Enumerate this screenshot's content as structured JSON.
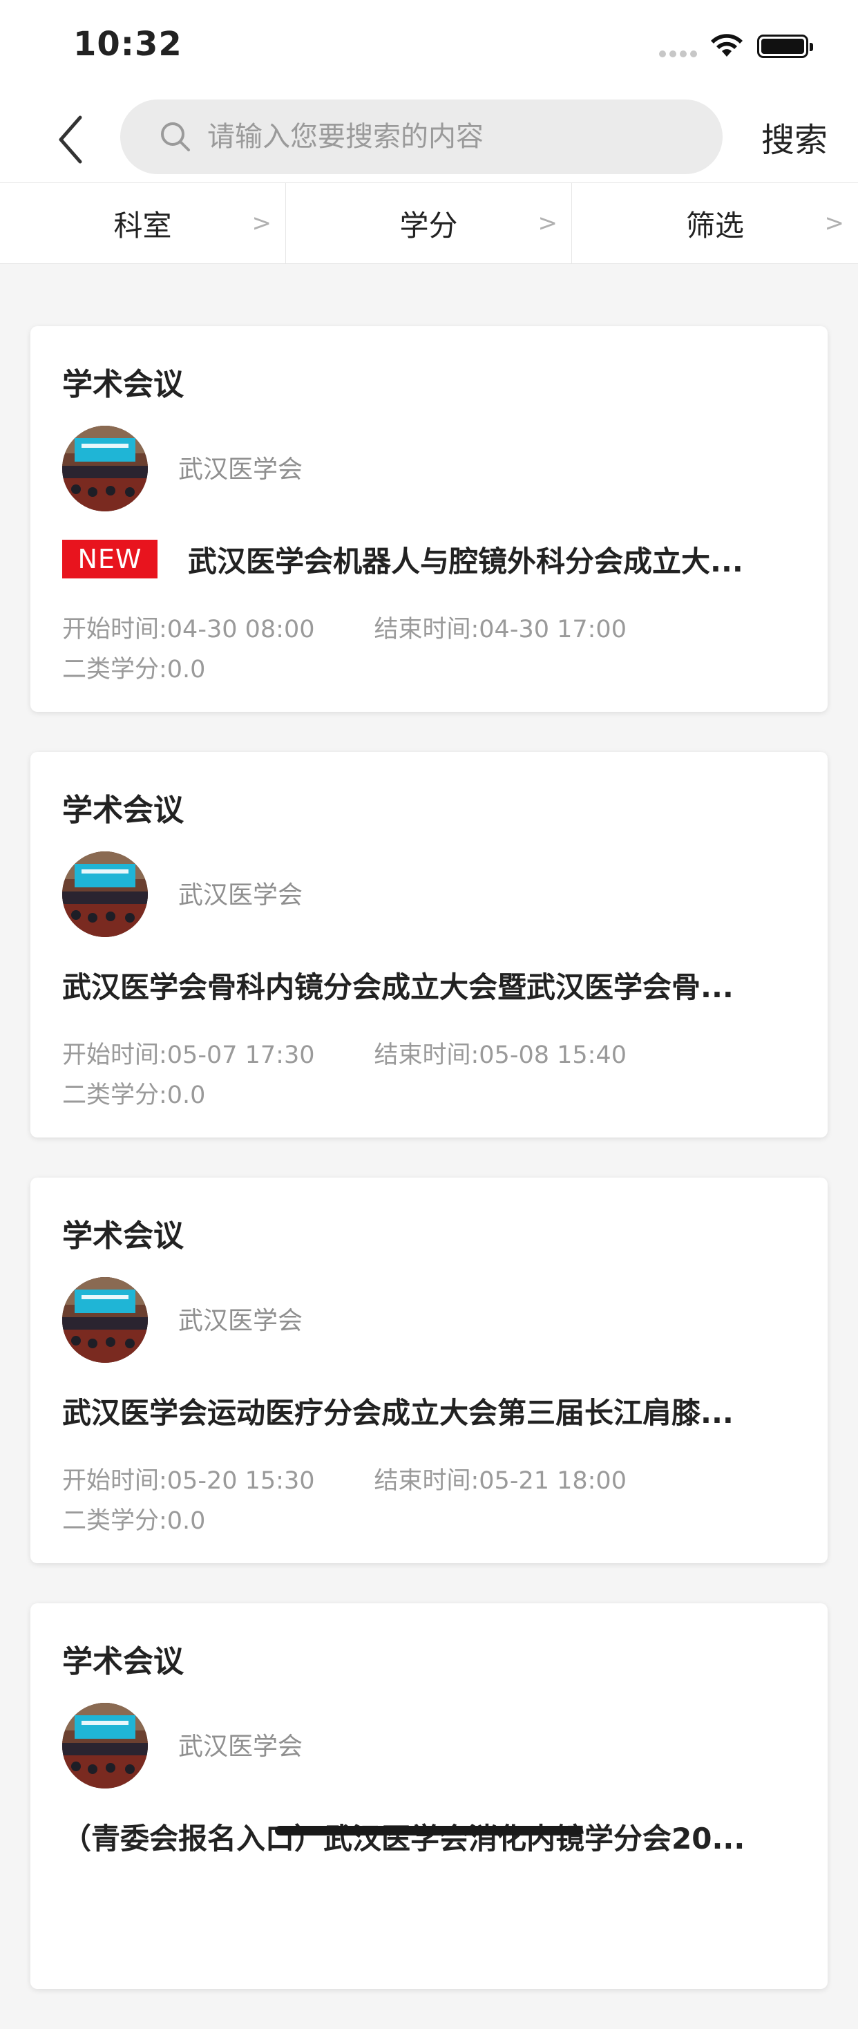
{
  "status_bar": {
    "time": "10:32"
  },
  "nav": {
    "search_placeholder": "请输入您要搜索的内容",
    "search_button": "搜索",
    "icons": {
      "back": "chevron-left-icon",
      "search": "magnifier-icon"
    }
  },
  "filters": [
    {
      "label": "科室",
      "arrow": ">"
    },
    {
      "label": "学分",
      "arrow": ">"
    },
    {
      "label": "筛选",
      "arrow": ">"
    }
  ],
  "cards": [
    {
      "type": "学术会议",
      "org": "武汉医学会",
      "badge": "NEW",
      "title": "武汉医学会机器人与腔镜外科分会成立大...",
      "start": "开始时间:04-30 08:00",
      "end": "结束时间:04-30 17:00",
      "credit": "二类学分:0.0"
    },
    {
      "type": "学术会议",
      "org": "武汉医学会",
      "badge": "",
      "title": "武汉医学会骨科内镜分会成立大会暨武汉医学会骨...",
      "start": "开始时间:05-07 17:30",
      "end": "结束时间:05-08 15:40",
      "credit": "二类学分:0.0"
    },
    {
      "type": "学术会议",
      "org": "武汉医学会",
      "badge": "",
      "title": "武汉医学会运动医疗分会成立大会第三届长江肩膝...",
      "start": "开始时间:05-20 15:30",
      "end": "结束时间:05-21 18:00",
      "credit": "二类学分:0.0"
    },
    {
      "type": "学术会议",
      "org": "武汉医学会",
      "badge": "",
      "title": "（青委会报名入口）武汉医学会消化内镜学分会20...",
      "start": "",
      "end": "",
      "credit": ""
    }
  ],
  "colors": {
    "accent_red": "#e8141e",
    "background": "#f5f5f5",
    "muted_text": "#9a9a9a"
  }
}
